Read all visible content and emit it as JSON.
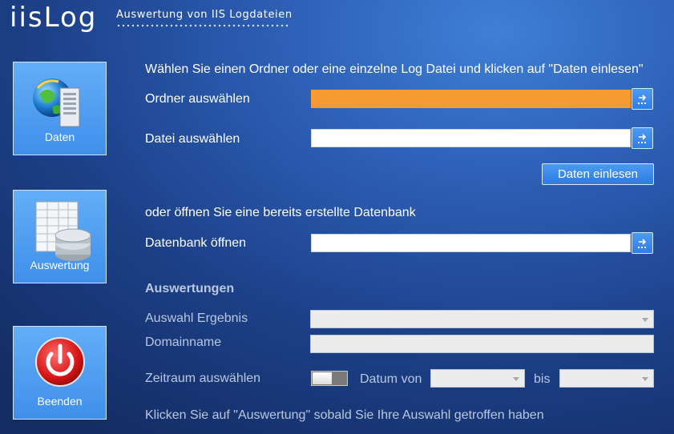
{
  "header": {
    "logo": "iisLog",
    "subtitle": "Auswertung von IIS Logdateien"
  },
  "sidebar": {
    "daten_label": "Daten",
    "auswertung_label": "Auswertung",
    "beenden_label": "Beenden"
  },
  "main": {
    "instruction": "Wählen Sie einen Ordner oder eine einzelne Log Datei und klicken auf \"Daten einlesen\"",
    "ordner_label": "Ordner auswählen",
    "ordner_value": "",
    "datei_label": "Datei auswählen",
    "datei_value": "",
    "daten_einlesen_button": "Daten einlesen",
    "or_text": "oder öffnen Sie eine bereits erstellte Datenbank",
    "datenbank_label": "Datenbank öffnen",
    "datenbank_value": ""
  },
  "auswertungen": {
    "heading": "Auswertungen",
    "ergebnis_label": "Auswahl Ergebnis",
    "ergebnis_value": "",
    "domain_label": "Domainname",
    "domain_value": "",
    "zeitraum_label": "Zeitraum auswählen",
    "zeitraum_enabled": false,
    "datum_von_label": "Datum von",
    "datum_von_value": "",
    "bis_label": "bis",
    "bis_value": "",
    "hint": "Klicken Sie auf \"Auswertung\" sobald Sie Ihre Auswahl getroffen haben"
  },
  "colors": {
    "accent": "#3f8fea",
    "highlight_field": "#f69a32"
  },
  "icons": {
    "daten": "globe-server-icon",
    "auswertung": "spreadsheet-database-icon",
    "beenden": "power-icon",
    "browse": "browse-arrow-icon"
  }
}
